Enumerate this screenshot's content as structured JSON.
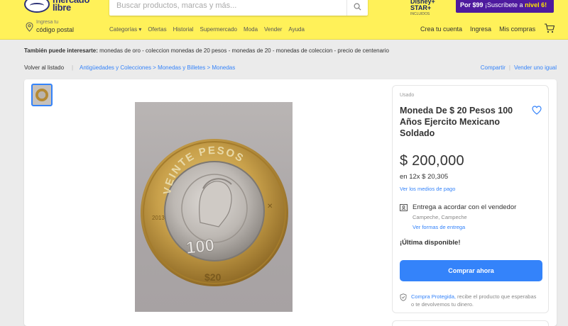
{
  "header": {
    "logo_line1": "mercado",
    "logo_line2": "libre",
    "search_placeholder": "Buscar productos, marcas y más...",
    "disney_label": "Disney+ STAR+",
    "disney_sub": "INCLUIDOS",
    "promo_price": "Por $99",
    "promo_text": " ¡Suscríbete a ",
    "promo_level": "nivel 6!",
    "location_small": "Ingresa tu",
    "location_big": "código postal",
    "nav": [
      "Categorías ▾",
      "Ofertas",
      "Historial",
      "Supermercado",
      "Moda",
      "Vender",
      "Ayuda"
    ],
    "user_nav": [
      "Crea tu cuenta",
      "Ingresa",
      "Mis compras"
    ]
  },
  "suggestions": {
    "label": "También puede interesarte:",
    "items": "monedas de oro - coleccion monedas de 20 pesos - monedas de 20 - monedas de coleccion - precio de centenario"
  },
  "breadcrumb": {
    "back": "Volver al listado",
    "path": "Antigüedades y Colecciones > Monedas y Billetes > Monedas",
    "share": "Compartir",
    "sell": "Vender uno igual"
  },
  "product": {
    "condition": "Usado",
    "title": "Moneda De $ 20 Pesos 100 Años Ejercito Mexicano Soldado",
    "price": "$ 200,000",
    "installments": "en 12x $ 20,305",
    "payment_link": "Ver los medios de pago",
    "shipping": "Entrega a acordar con el vendedor",
    "ship_location": "Campeche, Campeche",
    "ship_link": "Ver formas de entrega",
    "stock": "¡Última disponible!",
    "buy_label": "Comprar ahora",
    "protect_link": "Compra Protegida,",
    "protect_text": " recibe el producto que esperabas o te devolvemos tu dinero."
  },
  "coin": {
    "top_text": "VEINTE PESOS",
    "year": "2013",
    "hundred": "100",
    "value": "$20"
  },
  "colors": {
    "header_bg": "#fff159",
    "accent_blue": "#3483fa",
    "promo_purple": "#4e1a9e"
  }
}
